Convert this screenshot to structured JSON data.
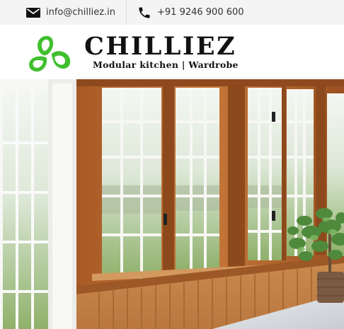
{
  "topbar": {
    "email": "info@chilliez.in",
    "phone": "+91 9246 900 600",
    "email_icon": "envelope-icon",
    "phone_icon": "phone-icon"
  },
  "brand": {
    "name": "CHILLIEZ",
    "tagline": "Modular kitchen | Wardrobe",
    "logo": "three-leaf-logo",
    "colors": {
      "logo_green": "#3fbf2e",
      "text": "#111111",
      "topbar_bg": "#f4f4f4"
    }
  },
  "hero": {
    "image": "sunroom-wooden-windows-photo"
  }
}
